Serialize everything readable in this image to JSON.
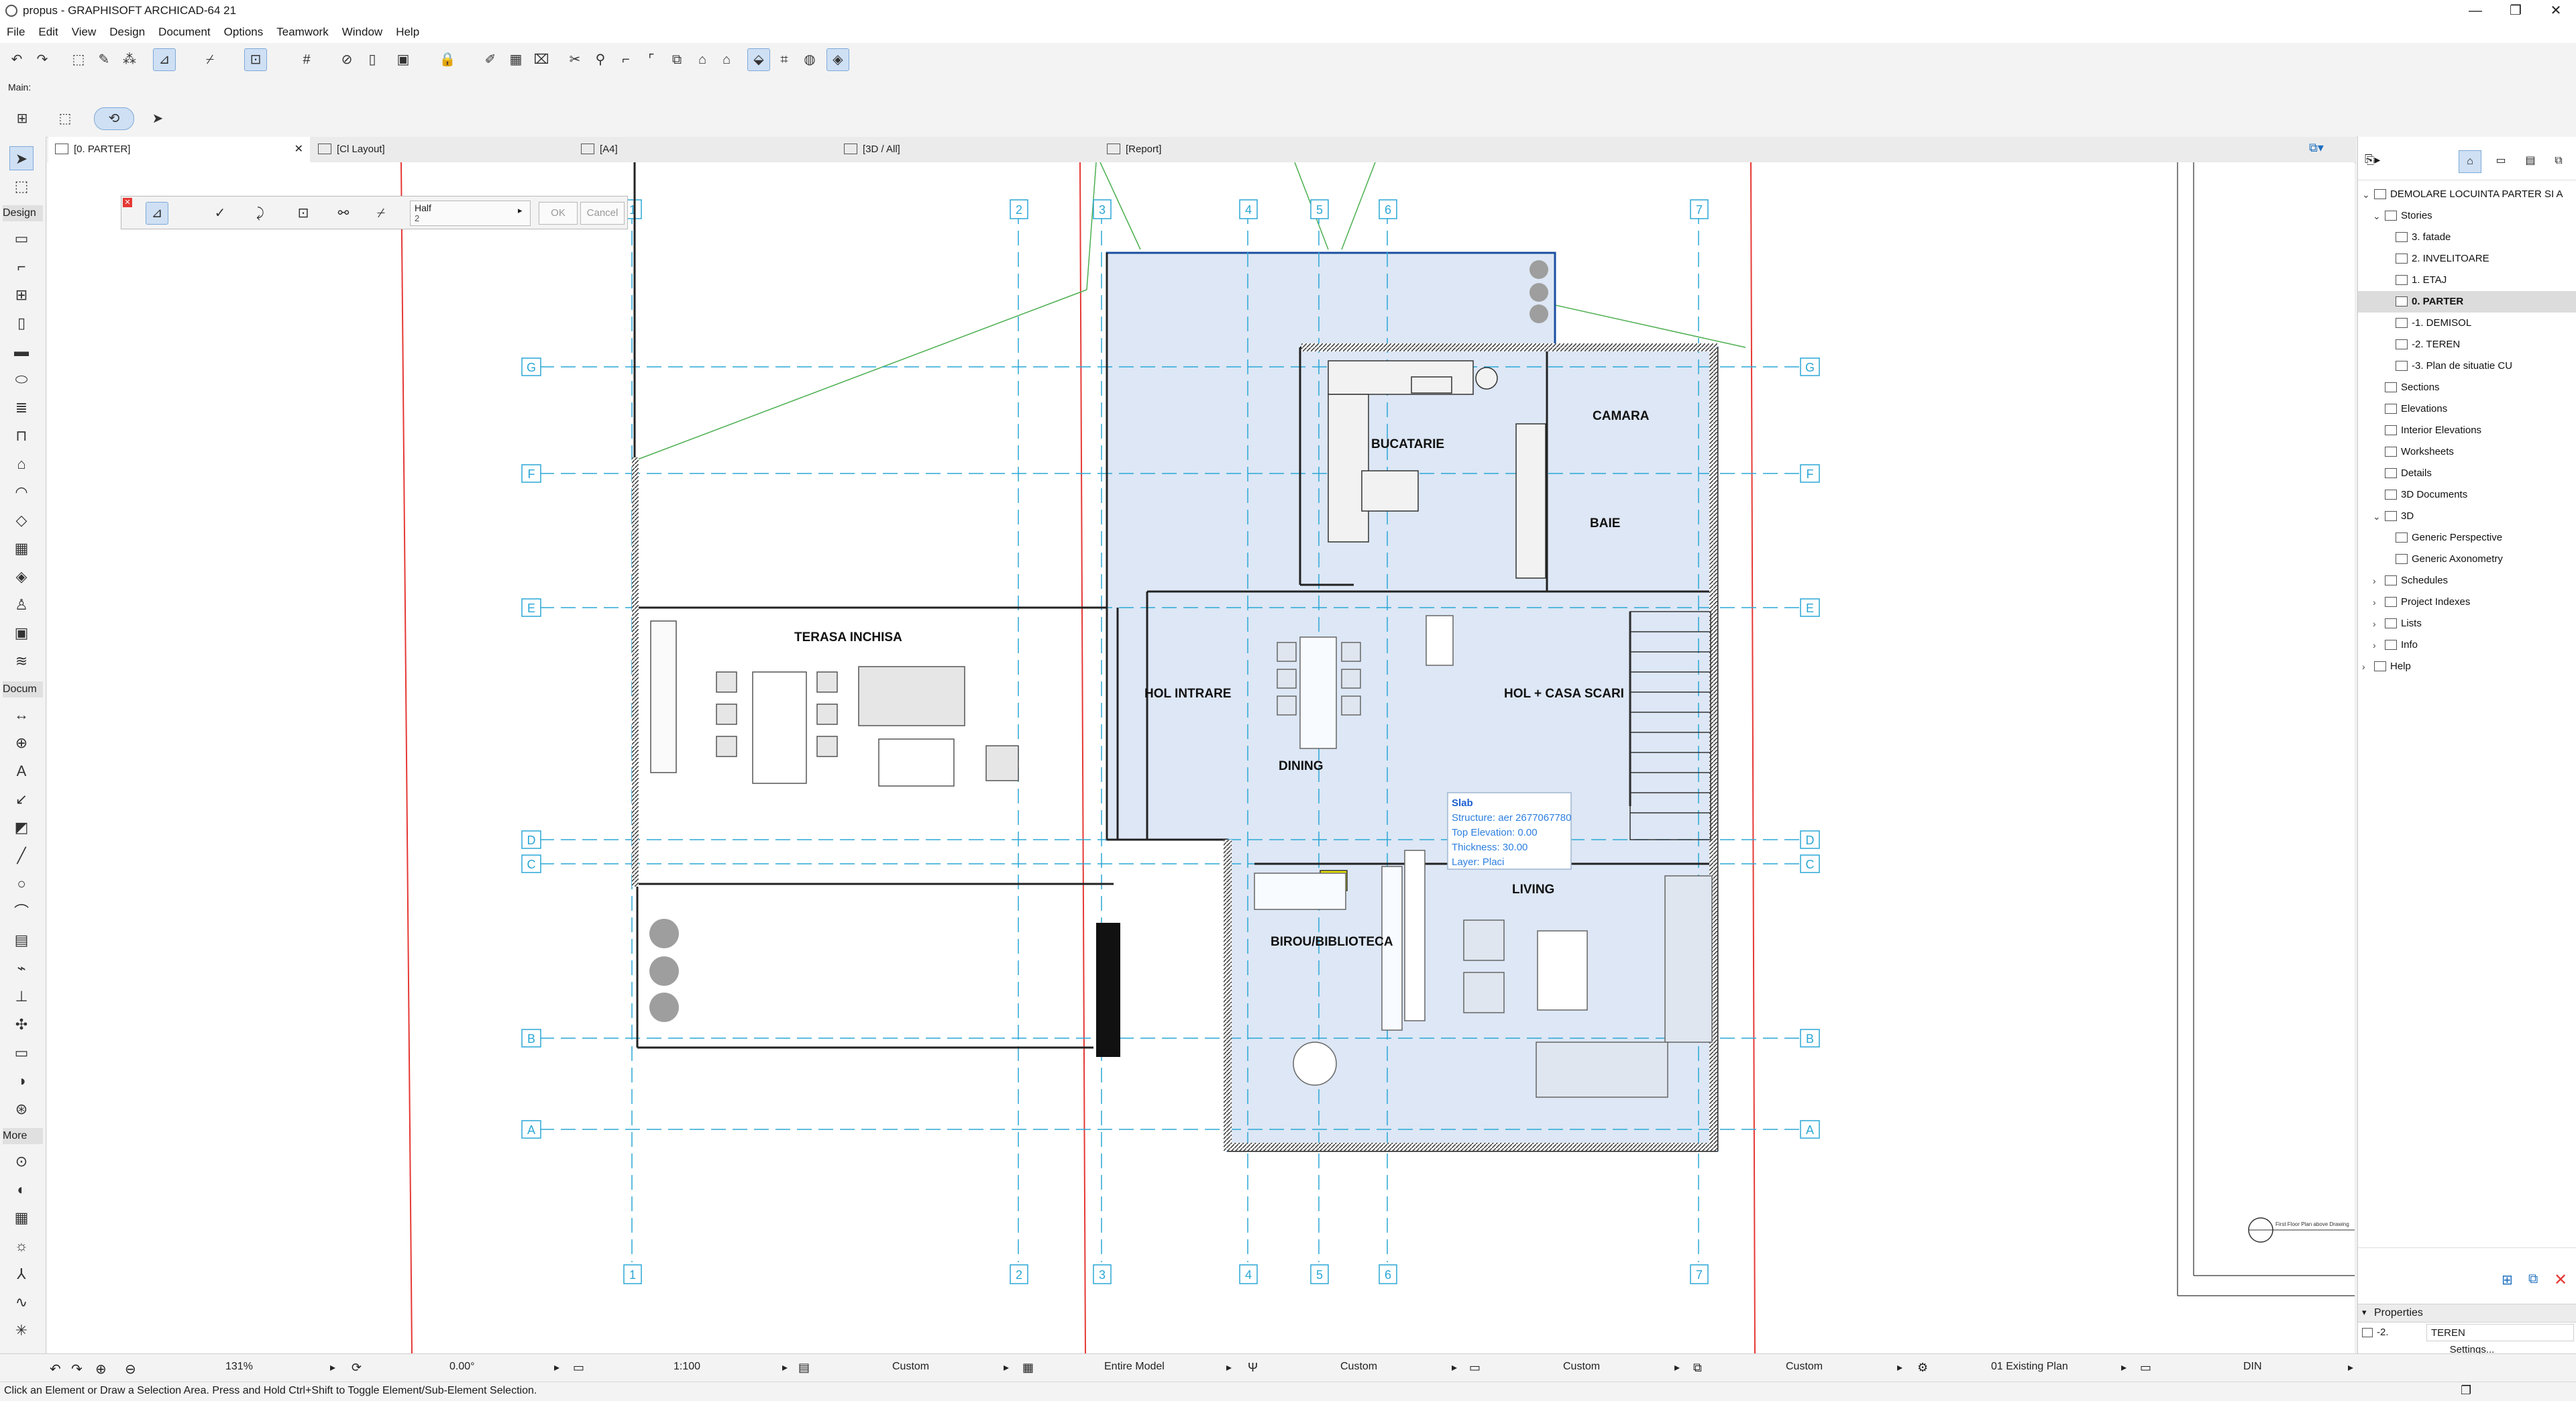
{
  "window": {
    "title": "propus - GRAPHISOFT ARCHICAD-64 21"
  },
  "menubar": [
    "File",
    "Edit",
    "View",
    "Design",
    "Document",
    "Options",
    "Teamwork",
    "Window",
    "Help"
  ],
  "toolbar2": {
    "main_label": "Main:"
  },
  "tabs": [
    {
      "label": "[0. PARTER]",
      "active": true
    },
    {
      "label": "[Cl Layout]"
    },
    {
      "label": "[A4]"
    },
    {
      "label": "[3D / All]"
    },
    {
      "label": "[Report]"
    }
  ],
  "toolbox": {
    "groups": [
      "Design",
      "Docum",
      "More"
    ]
  },
  "infobox": {
    "mode_label": "Half",
    "mode_sub": "2",
    "ok_label": "OK",
    "cancel_label": "Cancel"
  },
  "plan": {
    "rooms": [
      "BUCATARIE",
      "CAMARA",
      "BAIE",
      "TERASA INCHISA",
      "HOL INTRARE",
      "HOL + CASA SCARI",
      "DINING",
      "LIVING",
      "BIROU/BIBLIOTECA"
    ],
    "grid_letters": [
      "G",
      "F",
      "E",
      "D",
      "C",
      "B",
      "A"
    ],
    "grid_numbers": [
      "1",
      "2",
      "3",
      "4",
      "5",
      "6",
      "7"
    ],
    "tooltip": {
      "title": "Slab",
      "lines": [
        "Structure: aer 2677067780",
        "Top Elevation: 0.00",
        "Thickness: 30.00",
        "Layer: Placi"
      ]
    },
    "title_block": "First Floor Plan above Drawing"
  },
  "navigator": {
    "root": "DEMOLARE LOCUINTA PARTER SI A",
    "items": [
      {
        "label": "Stories"
      },
      {
        "label": "3. fatade"
      },
      {
        "label": "2. INVELITOARE"
      },
      {
        "label": "1. ETAJ"
      },
      {
        "label": "0. PARTER",
        "selected": true
      },
      {
        "label": "-1. DEMISOL"
      },
      {
        "label": "-2. TEREN"
      },
      {
        "label": "-3. Plan de situatie CU"
      },
      {
        "label": "Sections"
      },
      {
        "label": "Elevations"
      },
      {
        "label": "Interior Elevations"
      },
      {
        "label": "Worksheets"
      },
      {
        "label": "Details"
      },
      {
        "label": "3D Documents"
      },
      {
        "label": "3D"
      },
      {
        "label": "Generic Perspective"
      },
      {
        "label": "Generic Axonometry"
      },
      {
        "label": "Schedules"
      },
      {
        "label": "Project Indexes"
      },
      {
        "label": "Lists"
      },
      {
        "label": "Info"
      },
      {
        "label": "Help"
      }
    ],
    "properties": {
      "header": "Properties",
      "id": "-2.",
      "name": "TEREN",
      "settings_label": "Settings..."
    }
  },
  "statusbar": {
    "zoom": "131%",
    "angle": "0.00°",
    "scale": "1:100",
    "layer_combo": "Custom",
    "model_view": "Entire Model",
    "pen_set": "Custom",
    "dim": "Custom",
    "renovation": "Custom",
    "renovation_filter": "01 Existing Plan",
    "dimension_std": "DIN"
  },
  "hint": "Click an Element or Draw a Selection Area. Press and Hold Ctrl+Shift to Toggle Element/Sub-Element Selection.",
  "colors": {
    "grid": "#2aa7d6",
    "selection": "#1a4fa0",
    "slab_fill": "#dde7f5",
    "redline": "#e53935",
    "greenline": "#4caf50"
  }
}
